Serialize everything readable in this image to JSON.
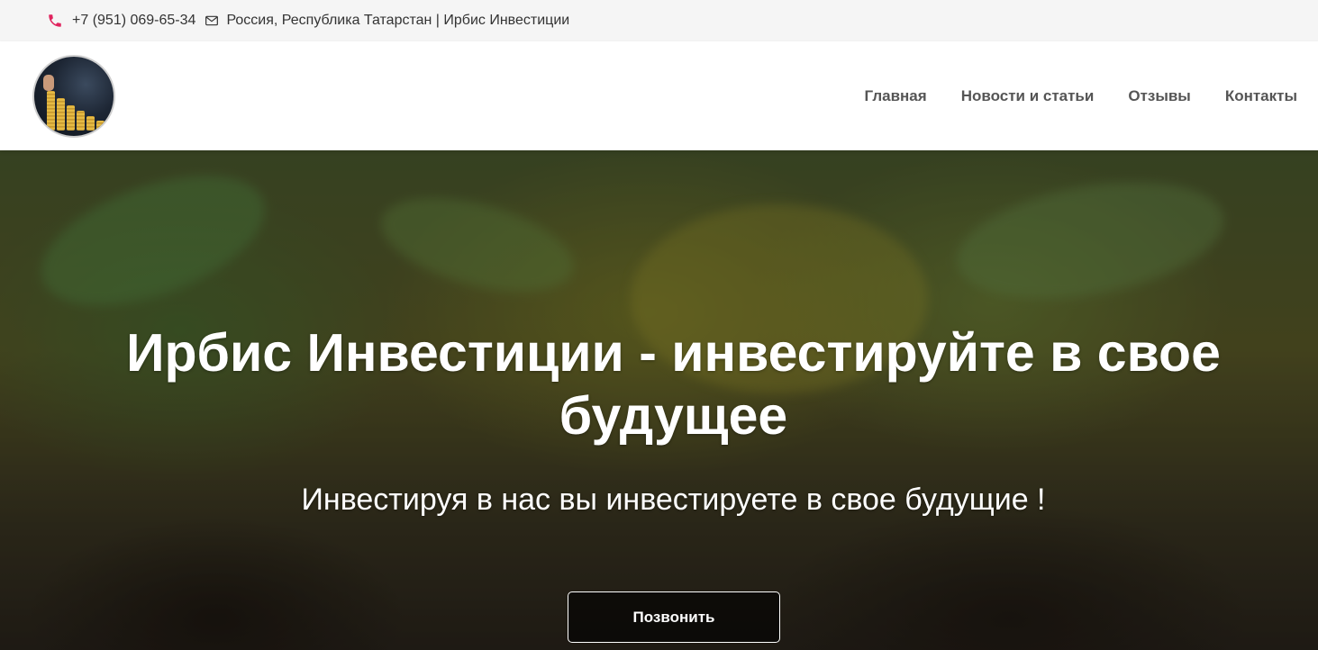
{
  "topbar": {
    "phone": "+7 (951) 069-65-34",
    "address": "Россия, Республика Татарстан | Ирбис Инвестиции",
    "phone_icon_color": "#e0245e",
    "icons": [
      "phone-icon",
      "mail-icon"
    ]
  },
  "header": {
    "logo_alt": "logo",
    "nav": [
      {
        "label": "Главная"
      },
      {
        "label": "Новости и статьи"
      },
      {
        "label": "Отзывы"
      },
      {
        "label": "Контакты"
      }
    ]
  },
  "hero": {
    "title": "Ирбис Инвестиции - инвестируйте в свое будущее",
    "subtitle": "Инвестируя в нас вы инвестируете в свое будущие !",
    "button_label": "Позвонить"
  },
  "colors": {
    "topbar_bg": "#f5f5f5",
    "nav_text": "#555555",
    "hero_text": "#ffffff"
  }
}
